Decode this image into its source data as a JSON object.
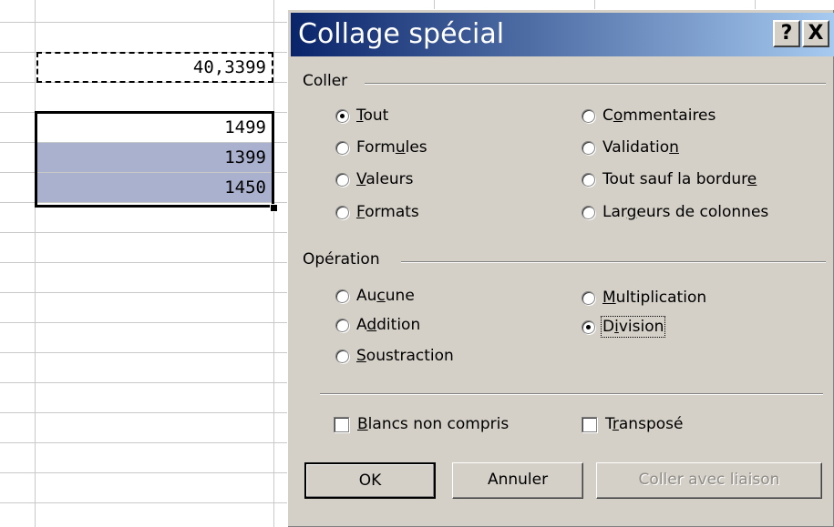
{
  "sheet": {
    "copied_cell": "40,3399",
    "cells": [
      "1499",
      "1399",
      "1450"
    ]
  },
  "dialog": {
    "title": "Collage spécial",
    "help_button": "?",
    "close_button": "X",
    "coller": {
      "label": "Coller",
      "options": [
        {
          "pre": "",
          "u": "T",
          "post": "out",
          "selected": true
        },
        {
          "pre": "Form",
          "u": "u",
          "post": "les",
          "selected": false
        },
        {
          "pre": "",
          "u": "V",
          "post": "aleurs",
          "selected": false
        },
        {
          "pre": "",
          "u": "F",
          "post": "ormats",
          "selected": false
        },
        {
          "pre": "C",
          "u": "o",
          "post": "mmentaires",
          "selected": false
        },
        {
          "pre": "Validatio",
          "u": "n",
          "post": "",
          "selected": false
        },
        {
          "pre": "Tout sauf la bordur",
          "u": "e",
          "post": "",
          "selected": false
        },
        {
          "pre": "Lar",
          "u": "g",
          "post": "eurs de colonnes",
          "selected": false
        }
      ]
    },
    "operation": {
      "label": "Opération",
      "options": [
        {
          "pre": "Au",
          "u": "c",
          "post": "une",
          "selected": false
        },
        {
          "pre": "A",
          "u": "d",
          "post": "dition",
          "selected": false
        },
        {
          "pre": "",
          "u": "S",
          "post": "oustraction",
          "selected": false
        },
        {
          "pre": "",
          "u": "M",
          "post": "ultiplication",
          "selected": false
        },
        {
          "pre": "D",
          "u": "i",
          "post": "vision",
          "selected": true
        }
      ]
    },
    "checkboxes": [
      {
        "pre": "",
        "u": "B",
        "post": "lancs non compris",
        "checked": false
      },
      {
        "pre": "T",
        "u": "r",
        "post": "ansposé",
        "checked": false
      }
    ],
    "buttons": {
      "ok": "OK",
      "cancel": "Annuler",
      "paste_link": "Coller avec liaison"
    }
  }
}
